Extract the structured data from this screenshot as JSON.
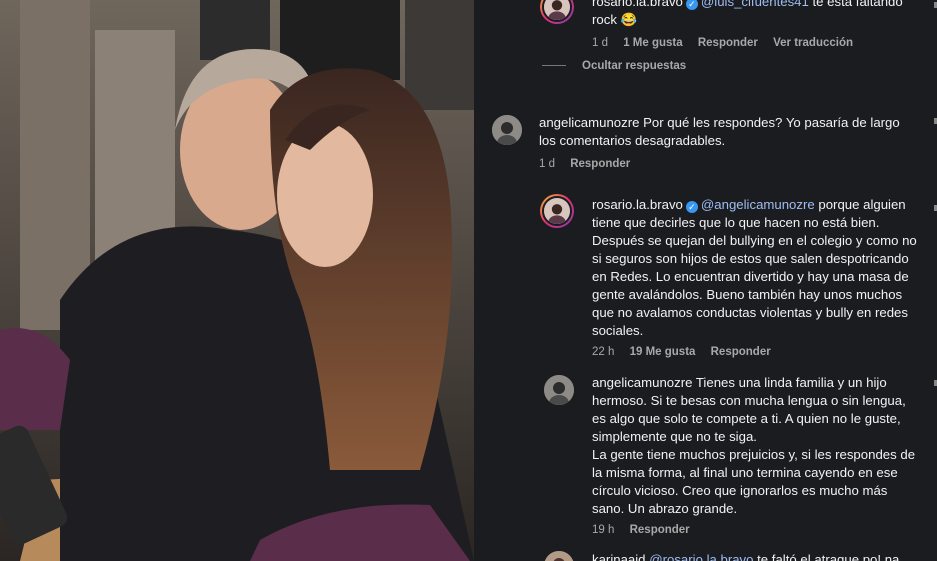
{
  "colors": {
    "panel_bg": "#1a1c20",
    "mention": "#9fbdf0",
    "meta": "#a8a8a8",
    "verified": "#3897f0"
  },
  "comments": [
    {
      "user": "rosario.la.bravo",
      "verified": true,
      "mention": "@luis_cifuentes41",
      "text": " te está faltando rock 😂",
      "time": "1 d",
      "likes": "1 Me gusta",
      "reply": "Responder",
      "translate": "Ver traducción"
    },
    {
      "user": "angelicamunozre",
      "text": " Por qué les respondes? Yo pasaría de largo los comentarios desagradables.",
      "time": "1 d",
      "reply": "Responder"
    },
    {
      "user": "rosario.la.bravo",
      "verified": true,
      "mention": "@angelicamunozre",
      "text": " porque alguien tiene que decirles que lo que hacen no está bien. Después se quejan del bullying en el colegio y como no si seguros son hijos de estos que salen despotricando en Redes. Lo encuentran divertido y hay una masa de gente avalándolos. Bueno también hay unos muchos que no avalamos conductas violentas y bully en redes sociales.",
      "time": "22 h",
      "likes": "19 Me gusta",
      "reply": "Responder"
    },
    {
      "user": "angelicamunozre",
      "text": " Tienes una linda familia y un hijo hermoso. Si te besas con mucha lengua o sin lengua, es algo que solo te compete a ti. A quien no le guste, simplemente que no te siga.\nLa gente tiene muchos prejuicios y, si les respondes de la misma forma, al final uno termina cayendo en ese círculo vicioso. Creo que ignorarlos es mucho más sano. Un abrazo grande.",
      "time": "19 h",
      "reply": "Responder"
    },
    {
      "user": "karinaaid",
      "mention": "@rosario.la.bravo",
      "text": " te faltó el atraque po! na"
    }
  ],
  "hide_replies": "Ocultar respuestas"
}
